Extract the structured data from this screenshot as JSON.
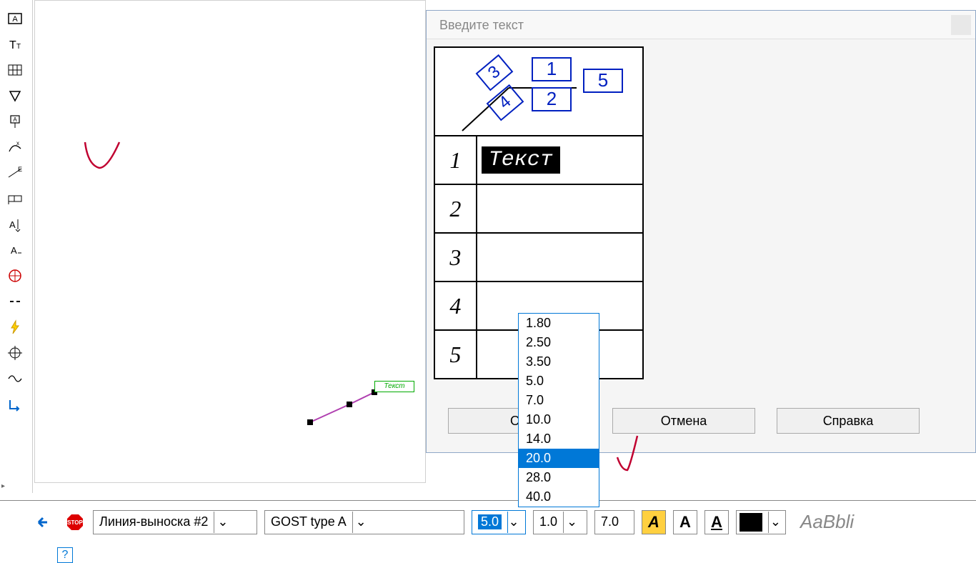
{
  "toolbar": {
    "icons": [
      "text-box-icon",
      "text-caps-icon",
      "grid-icon",
      "nabla-icon",
      "callout-box-icon",
      "xy-icon",
      "dimension-e-icon",
      "datum-icon",
      "align-vertical-icon",
      "text-partial-icon",
      "target-bulb-icon",
      "dash-icon",
      "lightning-icon",
      "crosshair-icon",
      "wave-icon",
      "arrow-corner-icon"
    ]
  },
  "canvas": {
    "leader_label": "Текст"
  },
  "dialog": {
    "title": "Введите текст",
    "diagram_labels": {
      "n1": "1",
      "n2": "2",
      "n3": "3",
      "n4": "4",
      "n5": "5"
    },
    "rows": [
      {
        "num": "1",
        "text": "Текст"
      },
      {
        "num": "2",
        "text": ""
      },
      {
        "num": "3",
        "text": ""
      },
      {
        "num": "4",
        "text": ""
      },
      {
        "num": "5",
        "text": ""
      }
    ],
    "buttons": {
      "ok": "OK",
      "cancel": "Отмена",
      "help": "Справка"
    }
  },
  "size_dropdown": {
    "options": [
      "1.80",
      "2.50",
      "3.50",
      "5.0",
      "7.0",
      "10.0",
      "14.0",
      "20.0",
      "28.0",
      "40.0"
    ],
    "selected": "20.0"
  },
  "bottombar": {
    "style_name": "Линия-выноска #2",
    "font_name": "GOST type A",
    "size_value": "5.0",
    "spacing": "1.0",
    "extra": "7.0",
    "preview": "AaBbli"
  }
}
